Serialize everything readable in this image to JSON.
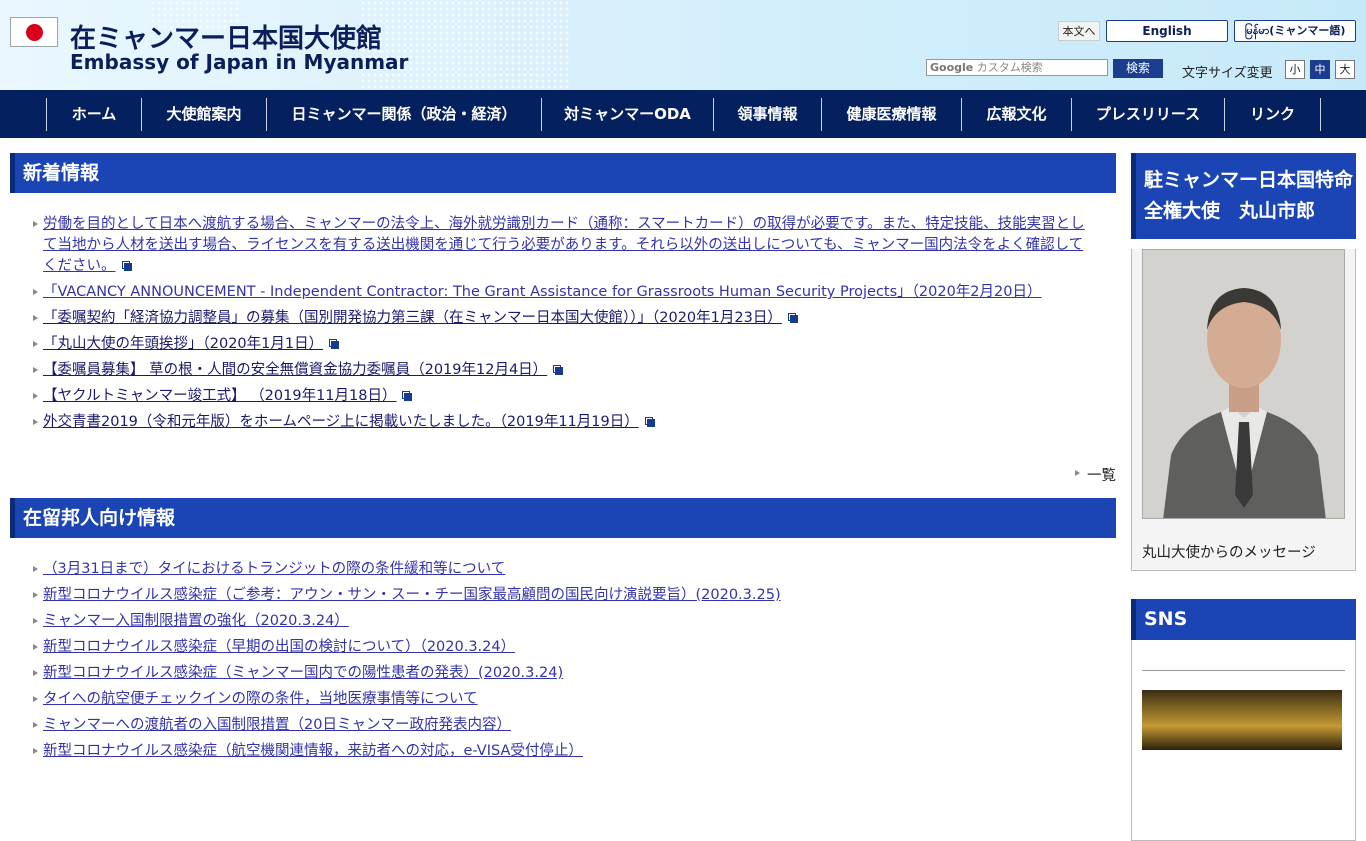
{
  "header": {
    "title": "在ミャンマー日本国大使館",
    "subtitle": "Embassy of Japan in Myanmar",
    "skip_label": "本文へ",
    "lang_english": "English",
    "lang_myanmar": "မြန်မာ(ミャンマー語)",
    "search_brand": "Google",
    "search_placeholder": "カスタム検索",
    "search_button": "検索",
    "fontsize_label": "文字サイズ変更",
    "fontsize_small": "小",
    "fontsize_medium": "中",
    "fontsize_large": "大"
  },
  "nav": {
    "items": [
      "ホーム",
      "大使館案内",
      "日ミャンマー関係（政治・経済）",
      "対ミャンマーODA",
      "領事情報",
      "健康医療情報",
      "広報文化",
      "プレスリリース",
      "リンク"
    ]
  },
  "news": {
    "heading": "新着情報",
    "items": [
      "労働を目的として日本へ渡航する場合、ミャンマーの法令上、海外就労識別カード（通称：スマートカード）の取得が必要です。また、特定技能、技能実習として当地から人材を送出す場合、ライセンスを有する送出機関を通じて行う必要があります。それら以外の送出しについても、ミャンマー国内法令をよく確認してください。",
      "「VACANCY ANNOUNCEMENT - Independent Contractor: The Grant Assistance for Grassroots Human Security Projects」（2020年2月20日）",
      "「委嘱契約「経済協力調整員」の募集（国別開発協力第三課（在ミャンマー日本国大使館））」（2020年1月23日）",
      "「丸山大使の年頭挨拶」（2020年1月1日）",
      "【委嘱員募集】 草の根・人間の安全無償資金協力委嘱員（2019年12月4日）",
      "【ヤクルトミャンマー竣工式】 （2019年11月18日）",
      "外交青書2019（令和元年版）をホームページ上に掲載いたしました。（2019年11月19日）"
    ],
    "more": "一覧"
  },
  "residents": {
    "heading": "在留邦人向け情報",
    "items": [
      "（3月31日まで）タイにおけるトランジットの際の条件緩和等について",
      "新型コロナウイルス感染症（ご参考：アウン・サン・スー・チー国家最高顧問の国民向け演説要旨）(2020.3.25)",
      "ミャンマー入国制限措置の強化（2020.3.24）",
      "新型コロナウイルス感染症（早期の出国の検討について）（2020.3.24）",
      "新型コロナウイルス感染症（ミャンマー国内での陽性患者の発表）(2020.3.24)",
      "タイへの航空便チェックインの際の条件，当地医療事情等について",
      "ミャンマーへの渡航者の入国制限措置（20日ミャンマー政府発表内容）",
      "新型コロナウイルス感染症（航空機関連情報，来訪者への対応，e-VISA受付停止）"
    ]
  },
  "sidebar": {
    "ambassador_heading": "駐ミャンマー日本国特命全権大使　丸山市郎",
    "message_link": "丸山大使からのメッセージ",
    "sns_heading": "SNS"
  },
  "colors": {
    "nav_bg": "#04205e",
    "heading_bg": "#1b44b5",
    "link": "#3333aa"
  }
}
